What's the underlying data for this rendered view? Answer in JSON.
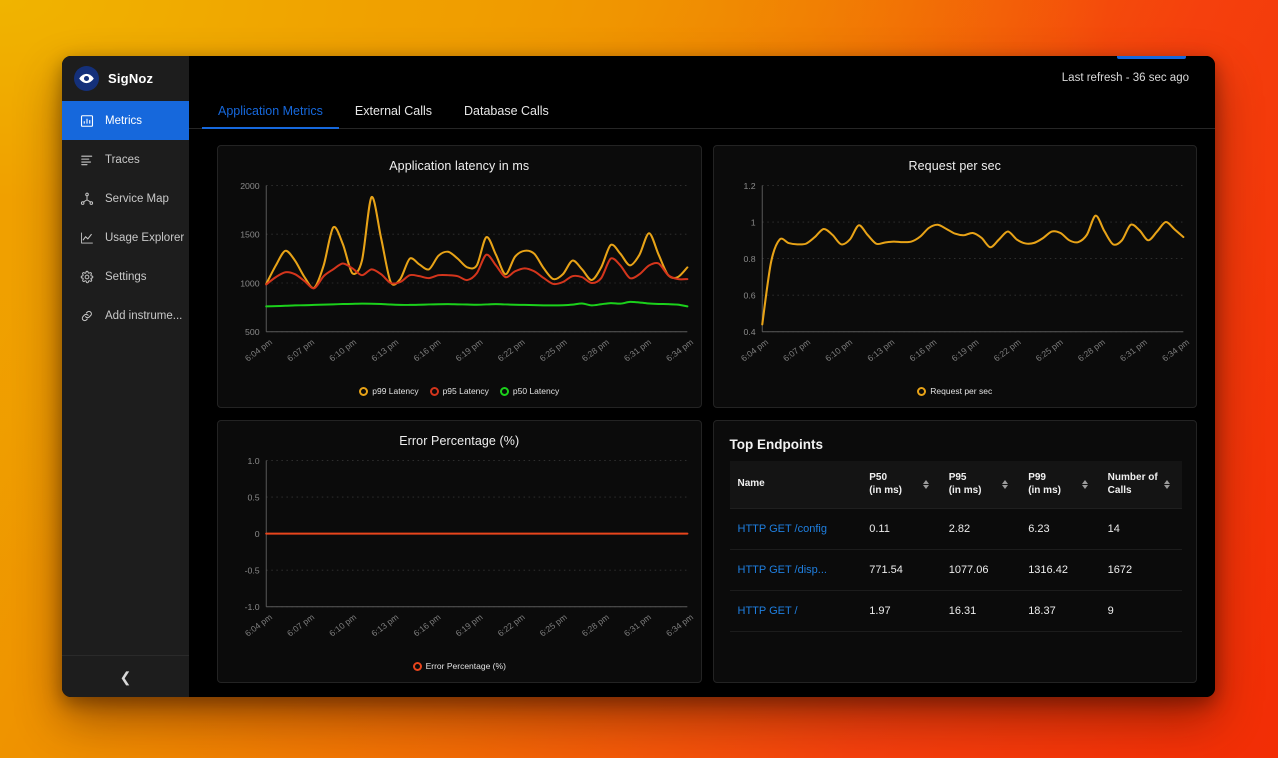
{
  "background": {
    "from": "#eea800",
    "to": "#f22d05"
  },
  "sidebar": {
    "brand": "SigNoz",
    "brand_icon": "eye-icon",
    "items": [
      {
        "label": "Metrics",
        "icon": "bar-chart-icon",
        "active": true
      },
      {
        "label": "Traces",
        "icon": "traces-icon",
        "active": false
      },
      {
        "label": "Service Map",
        "icon": "service-map-icon",
        "active": false
      },
      {
        "label": "Usage Explorer",
        "icon": "line-chart-icon",
        "active": false
      },
      {
        "label": "Settings",
        "icon": "gear-icon",
        "active": false
      },
      {
        "label": "Add instrume...",
        "icon": "link-icon",
        "active": false
      }
    ],
    "collapse_icon": "chevron-left-icon",
    "active_color": "#1668dc"
  },
  "topbar": {
    "refresh_text": "Last refresh - 36 sec ago"
  },
  "tabs": [
    {
      "label": "Application Metrics",
      "active": true
    },
    {
      "label": "External Calls",
      "active": false
    },
    {
      "label": "Database Calls",
      "active": false
    }
  ],
  "chart_data": [
    {
      "id": "latency",
      "type": "line",
      "title": "Application latency in ms",
      "xlabel": "",
      "ylabel": "",
      "ylim": [
        500,
        2000
      ],
      "yticks": [
        500,
        1000,
        1500,
        2000
      ],
      "grid": true,
      "legend_position": "bottom",
      "x": [
        "6:04 pm",
        "6:07 pm",
        "6:10 pm",
        "6:13 pm",
        "6:16 pm",
        "6:19 pm",
        "6:22 pm",
        "6:25 pm",
        "6:28 pm",
        "6:31 pm",
        "6:34 pm"
      ],
      "series": [
        {
          "name": "p99 Latency",
          "color": "#e8a317",
          "values": [
            990,
            1180,
            1330,
            1230,
            1060,
            950,
            1180,
            1570,
            1400,
            1100,
            1230,
            1880,
            1460,
            1010,
            1040,
            1250,
            1190,
            1140,
            1280,
            1320,
            1250,
            1160,
            1180,
            1470,
            1290,
            1090,
            1270,
            1330,
            1300,
            1150,
            1040,
            1090,
            1230,
            1140,
            1030,
            1160,
            1390,
            1300,
            1180,
            1290,
            1510,
            1290,
            1080,
            1060,
            1160
          ]
        },
        {
          "name": "p95 Latency",
          "color": "#d4351c",
          "values": [
            985,
            1060,
            1110,
            1090,
            1020,
            945,
            1070,
            1140,
            1200,
            1150,
            1080,
            1140,
            1090,
            1000,
            1010,
            1080,
            1070,
            1050,
            1080,
            1080,
            1070,
            1030,
            1100,
            1290,
            1180,
            1060,
            1120,
            1150,
            1120,
            1050,
            990,
            1010,
            1070,
            1060,
            1000,
            1050,
            1250,
            1180,
            1050,
            1090,
            1180,
            1200,
            1080,
            1040,
            1040
          ]
        },
        {
          "name": "p50 Latency",
          "color": "#1bd11b",
          "values": [
            760,
            763,
            766,
            770,
            772,
            775,
            778,
            781,
            784,
            786,
            788,
            787,
            784,
            779,
            776,
            775,
            777,
            780,
            782,
            783,
            781,
            779,
            777,
            780,
            783,
            780,
            777,
            775,
            773,
            771,
            770,
            772,
            778,
            790,
            770,
            782,
            794,
            788,
            806,
            800,
            790,
            785,
            783,
            778,
            760
          ]
        }
      ]
    },
    {
      "id": "rps",
      "type": "line",
      "title": "Request per sec",
      "xlabel": "",
      "ylabel": "",
      "ylim": [
        0.4,
        1.2
      ],
      "yticks": [
        0.4,
        0.6,
        0.8,
        1.0,
        1.2
      ],
      "grid": true,
      "legend_position": "bottom",
      "x": [
        "6:04 pm",
        "6:07 pm",
        "6:10 pm",
        "6:13 pm",
        "6:16 pm",
        "6:19 pm",
        "6:22 pm",
        "6:25 pm",
        "6:28 pm",
        "6:31 pm",
        "6:34 pm"
      ],
      "series": [
        {
          "name": "Request per sec",
          "color": "#e8a317",
          "values": [
            0.44,
            0.78,
            0.905,
            0.885,
            0.878,
            0.882,
            0.918,
            0.962,
            0.93,
            0.878,
            0.905,
            0.982,
            0.93,
            0.881,
            0.888,
            0.893,
            0.89,
            0.893,
            0.92,
            0.968,
            0.985,
            0.962,
            0.936,
            0.928,
            0.94,
            0.913,
            0.862,
            0.905,
            0.948,
            0.905,
            0.883,
            0.886,
            0.912,
            0.948,
            0.94,
            0.9,
            0.89,
            0.93,
            1.035,
            0.95,
            0.878,
            0.9,
            0.985,
            0.955,
            0.9,
            0.948,
            1.0,
            0.96,
            0.918
          ]
        }
      ]
    },
    {
      "id": "error-pct",
      "type": "line",
      "title": "Error Percentage (%)",
      "xlabel": "",
      "ylabel": "",
      "ylim": [
        -1.0,
        1.0
      ],
      "yticks": [
        "-1.0",
        "-0.5",
        "0",
        "0.5",
        "1.0"
      ],
      "grid": true,
      "legend_position": "bottom",
      "x": [
        "6:04 pm",
        "6:07 pm",
        "6:10 pm",
        "6:13 pm",
        "6:16 pm",
        "6:19 pm",
        "6:22 pm",
        "6:25 pm",
        "6:28 pm",
        "6:31 pm",
        "6:34 pm"
      ],
      "series": [
        {
          "name": "Error Percentage (%)",
          "color": "#e8451c",
          "values": [
            0,
            0,
            0,
            0,
            0,
            0,
            0,
            0,
            0,
            0,
            0,
            0,
            0,
            0,
            0,
            0,
            0,
            0,
            0,
            0,
            0,
            0,
            0,
            0,
            0,
            0,
            0,
            0,
            0,
            0,
            0,
            0,
            0,
            0,
            0,
            0,
            0,
            0,
            0,
            0,
            0,
            0,
            0,
            0,
            0
          ]
        }
      ]
    }
  ],
  "top_endpoints": {
    "title": "Top Endpoints",
    "columns": [
      {
        "line1": "Name",
        "line2": "",
        "sortable": false
      },
      {
        "line1": "P50",
        "line2": "(in ms)",
        "sortable": true
      },
      {
        "line1": "P95",
        "line2": "(in ms)",
        "sortable": true
      },
      {
        "line1": "P99",
        "line2": "(in ms)",
        "sortable": true
      },
      {
        "line1": "Number of",
        "line2": "Calls",
        "sortable": true
      }
    ],
    "rows": [
      {
        "name": "HTTP GET /config",
        "p50": "0.11",
        "p95": "2.82",
        "p99": "6.23",
        "calls": "14"
      },
      {
        "name": "HTTP GET /disp...",
        "p50": "771.54",
        "p95": "1077.06",
        "p99": "1316.42",
        "calls": "1672"
      },
      {
        "name": "HTTP GET /",
        "p50": "1.97",
        "p95": "16.31",
        "p99": "18.37",
        "calls": "9"
      }
    ]
  }
}
